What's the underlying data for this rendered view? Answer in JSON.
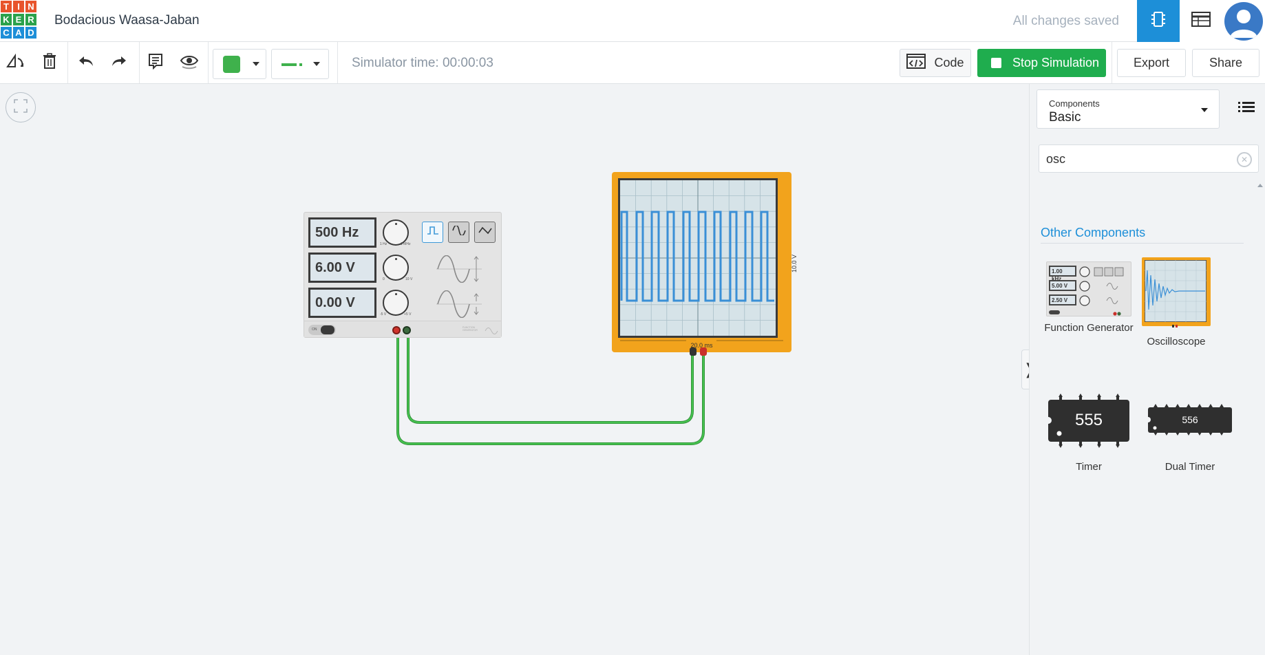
{
  "header": {
    "logo_letters": [
      "T",
      "I",
      "N",
      "K",
      "E",
      "R",
      "C",
      "A",
      "D"
    ],
    "logo_colors": [
      "#e8542c",
      "#e8542c",
      "#e8542c",
      "#2ba24c",
      "#2ba24c",
      "#2ba24c",
      "#1d8fd8",
      "#1d8fd8",
      "#1d8fd8"
    ],
    "title": "Bodacious Waasa-Jaban",
    "save_status": "All changes saved"
  },
  "toolbar": {
    "simulator_time": "Simulator time: 00:00:03",
    "code_label": "Code",
    "stop_label": "Stop Simulation",
    "export_label": "Export",
    "share_label": "Share",
    "wire_color": "#3fb14c"
  },
  "canvas": {
    "function_generator": {
      "frequency": "500 Hz",
      "amplitude": "6.00 V",
      "offset": "0.00 V",
      "knob1_min": "1 Hz",
      "knob1_max": "1 MHz",
      "knob2_min": "0",
      "knob2_max": "10 V",
      "knob3_min": "-5 V",
      "knob3_max": "+5 V",
      "switch_label": "ON",
      "brand": "FUNCTION GENERATOR"
    },
    "oscilloscope": {
      "time_per_div": "20.0 ms",
      "volts_per_div": "10.0 V"
    }
  },
  "panel": {
    "components_label": "Components",
    "components_value": "Basic",
    "search_value": "osc",
    "section_title": "Other Components",
    "items": [
      {
        "label": "Function Generator",
        "thumb": {
          "freq": "1.00 kHz",
          "amp": "5.00 V",
          "offset": "2.50 V"
        }
      },
      {
        "label": "Oscilloscope"
      },
      {
        "label": "Timer",
        "chip": "555"
      },
      {
        "label": "Dual Timer",
        "chip": "556"
      }
    ]
  }
}
